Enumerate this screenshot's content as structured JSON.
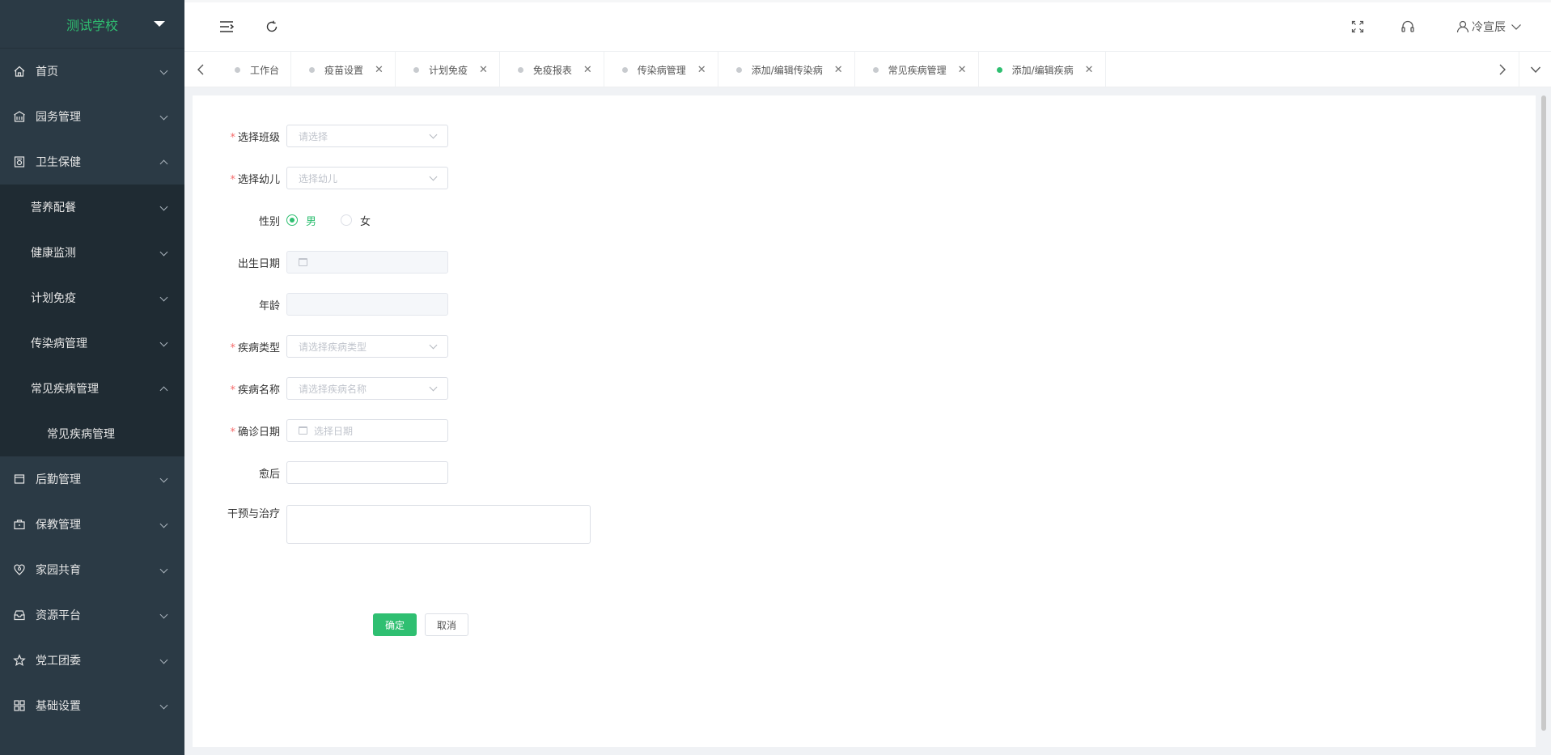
{
  "sidebar": {
    "school_name": "测试学校",
    "items": [
      {
        "label": "首页",
        "icon": "home-icon"
      },
      {
        "label": "园务管理",
        "icon": "building-icon"
      },
      {
        "label": "卫生保健",
        "icon": "health-icon"
      },
      {
        "label": "营养配餐"
      },
      {
        "label": "健康监测"
      },
      {
        "label": "计划免疫"
      },
      {
        "label": "传染病管理"
      },
      {
        "label": "常见疾病管理"
      },
      {
        "label": "常见疾病管理"
      },
      {
        "label": "后勤管理",
        "icon": "logistics-icon"
      },
      {
        "label": "保教管理",
        "icon": "briefcase-icon"
      },
      {
        "label": "家园共育",
        "icon": "heart-pin-icon"
      },
      {
        "label": "资源平台",
        "icon": "inbox-icon"
      },
      {
        "label": "党工团委",
        "icon": "star-icon"
      },
      {
        "label": "基础设置",
        "icon": "grid-icon"
      }
    ]
  },
  "header": {
    "username": "冷宣辰"
  },
  "tabs": [
    {
      "label": "工作台",
      "closable": false,
      "active": false
    },
    {
      "label": "疫苗设置",
      "closable": true,
      "active": false
    },
    {
      "label": "计划免疫",
      "closable": true,
      "active": false
    },
    {
      "label": "免疫报表",
      "closable": true,
      "active": false
    },
    {
      "label": "传染病管理",
      "closable": true,
      "active": false
    },
    {
      "label": "添加/编辑传染病",
      "closable": true,
      "active": false
    },
    {
      "label": "常见疾病管理",
      "closable": true,
      "active": false
    },
    {
      "label": "添加/编辑疾病",
      "closable": true,
      "active": true
    }
  ],
  "form": {
    "class_label": "选择班级",
    "class_placeholder": "请选择",
    "child_label": "选择幼儿",
    "child_placeholder": "选择幼儿",
    "gender_label": "性别",
    "gender_male": "男",
    "gender_female": "女",
    "birth_label": "出生日期",
    "age_label": "年龄",
    "disease_type_label": "疾病类型",
    "disease_type_placeholder": "请选择疾病类型",
    "disease_name_label": "疾病名称",
    "disease_name_placeholder": "请选择疾病名称",
    "diagnosis_date_label": "确诊日期",
    "diagnosis_date_placeholder": "选择日期",
    "prognosis_label": "愈后",
    "treatment_label": "干预与治疗",
    "required_mark": "*"
  },
  "actions": {
    "confirm": "确定",
    "cancel": "取消"
  },
  "colors": {
    "accent": "#2fbf71",
    "sidebar_bg": "#2b3a45",
    "required": "#f56c6c"
  }
}
